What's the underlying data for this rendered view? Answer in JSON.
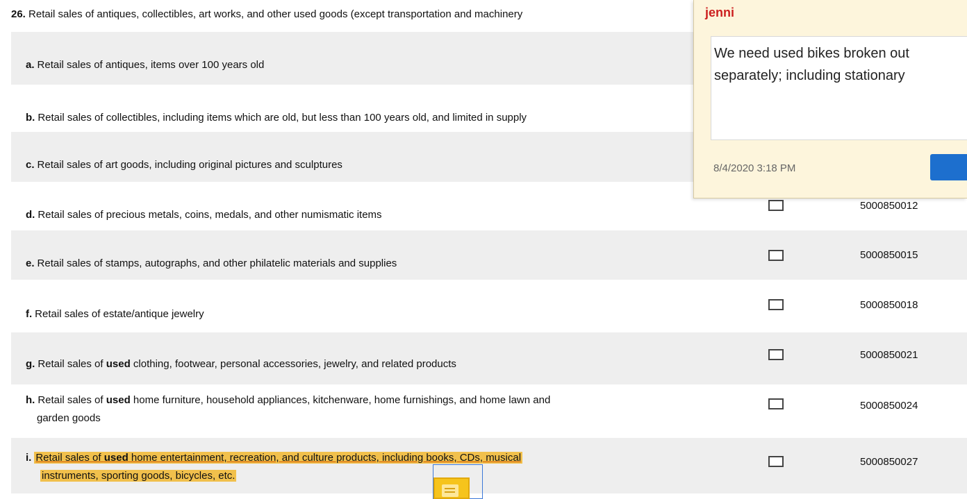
{
  "question": {
    "number": "26.",
    "text": "Retail sales of antiques, collectibles, art works, and other used goods (except transportation and machinery"
  },
  "items": [
    {
      "letter": "a.",
      "text": "Retail sales of antiques, items over 100 years old",
      "code": ""
    },
    {
      "letter": "b.",
      "text": "Retail sales of collectibles, including items which are old, but less than 100 years old, and limited in supply",
      "code": ""
    },
    {
      "letter": "c.",
      "text": "Retail sales of art goods, including original pictures and sculptures",
      "code": ""
    },
    {
      "letter": "d.",
      "text": "Retail sales of precious metals, coins, medals, and other numismatic items",
      "code": "5000850012"
    },
    {
      "letter": "e.",
      "text": "Retail sales of stamps, autographs, and other philatelic materials and supplies",
      "code": "5000850015"
    },
    {
      "letter": "f.",
      "text": "Retail sales of estate/antique jewelry",
      "code": "5000850018"
    },
    {
      "letter": "g.",
      "pre": "Retail sales of ",
      "bold": "used",
      "post": " clothing, footwear, personal accessories, jewelry, and related products",
      "code": "5000850021"
    },
    {
      "letter": "h.",
      "pre": "Retail sales of ",
      "bold": "used",
      "post": " home furniture, household appliances, kitchenware, home furnishings, and home lawn and",
      "line2": "garden goods",
      "code": "5000850024"
    },
    {
      "letter": "i.",
      "pre": "Retail sales of ",
      "bold": "used",
      "post": " home entertainment, recreation, and culture products, including books, CDs, musical",
      "line2": "instruments, sporting goods, bicycles, etc.",
      "code": "5000850027"
    }
  ],
  "comment": {
    "author": "jenni",
    "body_line1": "We need used bikes broken out",
    "body_line2": "separately; including stationary",
    "timestamp": "8/4/2020  3:18 PM"
  },
  "colors": {
    "highlight": "#f1c04c",
    "author": "#cc1f1f",
    "post_button": "#1d6fce",
    "comment_bg": "#fdf5dc"
  },
  "icons": {
    "sticky_note": "sticky-note-icon",
    "checkbox": "checkbox-icon"
  }
}
